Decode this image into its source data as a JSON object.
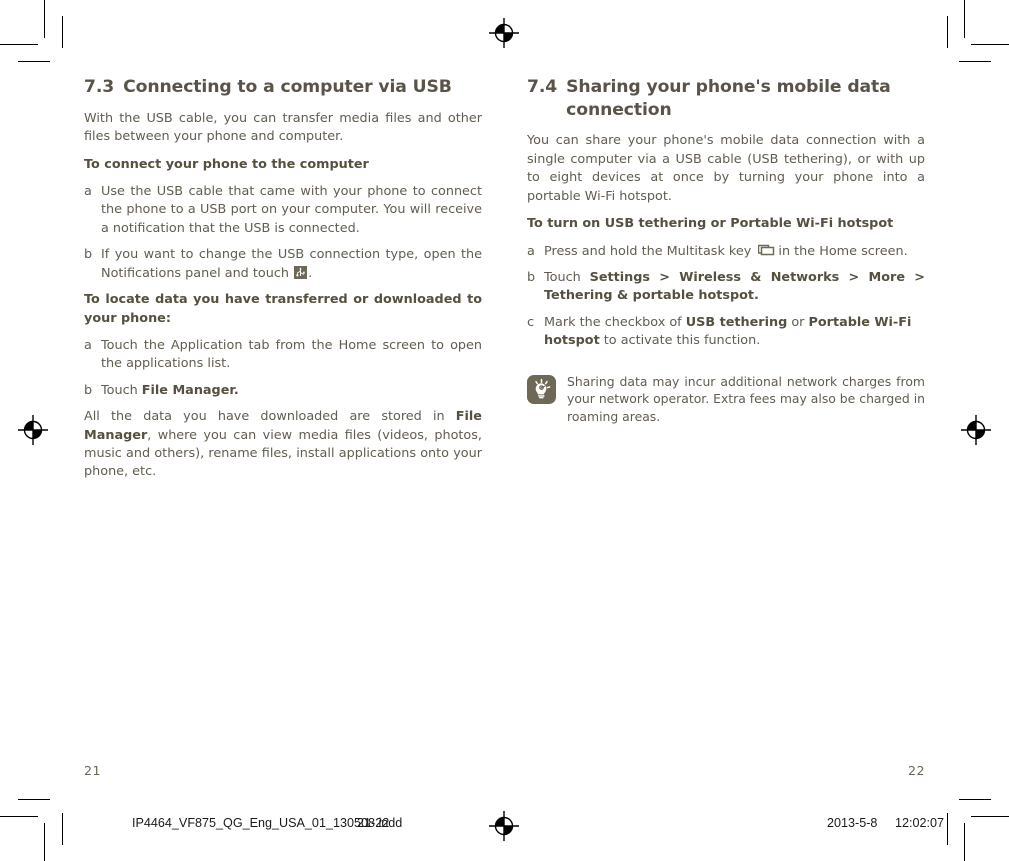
{
  "document": {
    "left_page_number": "21",
    "right_page_number": "22"
  },
  "left_column": {
    "section_number": "7.3",
    "section_title": "Connecting to a computer via USB",
    "intro": "With the USB cable, you can transfer media files and other files between your phone and computer.",
    "subhead_1": "To connect your phone to the computer",
    "step_a_label": "a",
    "step_a_text": "Use the USB cable that came with your phone to connect the phone to a USB port on your computer. You will receive a notification that the USB is connected.",
    "step_b_label": "b",
    "step_b_text_before": "If you want to change the USB connection type, open the Notifications panel and touch ",
    "step_b_icon_name": "usb-icon",
    "step_b_text_after": ".",
    "subhead_2": "To locate data you have transferred or downloaded to your phone:",
    "step_c_label": "a",
    "step_c_text": "Touch the Application tab from the Home screen to open the applications list.",
    "step_d_label": "b",
    "step_d_text_before": "Touch ",
    "step_d_text_bold": "File Manager.",
    "closing_before": "All the data you have downloaded are stored in ",
    "closing_bold": "File Manager",
    "closing_after": ", where you can view media files (videos, photos, music and others), rename files, install applications onto your phone, etc."
  },
  "right_column": {
    "section_number": "7.4",
    "section_title": "Sharing your phone's mobile data connection",
    "intro": "You can share your phone's mobile data connection with a single computer via a USB cable (USB tethering), or with up to eight devices at once by turning your phone into a portable Wi-Fi hotspot.",
    "subhead_1": "To turn on USB tethering or Portable Wi-Fi hotspot",
    "step_a_label": "a",
    "step_a_text_before": "Press and hold the Multitask key ",
    "step_a_icon_name": "multitask-key-icon",
    "step_a_text_after": "in the Home screen.",
    "step_b_label": "b",
    "step_b_text_before": "Touch ",
    "step_b_text_bold": "Settings > Wireless & Networks > More > Tethering & portable hotspot.",
    "step_c_label": "c",
    "step_c_text_before": "Mark the checkbox of ",
    "step_c_bold_1": "USB tethering",
    "step_c_text_mid": " or ",
    "step_c_bold_2": "Portable Wi-Fi hotspot",
    "step_c_text_after": " to activate this function.",
    "tip_icon_name": "lightbulb-tip-icon",
    "tip_text": "Sharing data may incur additional network charges from your network operator. Extra fees may also be charged in roaming areas."
  },
  "print_bar": {
    "filename": "IP4464_VF875_QG_Eng_USA_01_130508.indd",
    "page_range": "21-22",
    "date": "2013-5-8",
    "time": "12:02:07"
  },
  "colors": {
    "text": "#625c50",
    "heading": "#5a5349",
    "icon_badge": "#6e6857",
    "print_bar_text": "#1a1a1a"
  }
}
